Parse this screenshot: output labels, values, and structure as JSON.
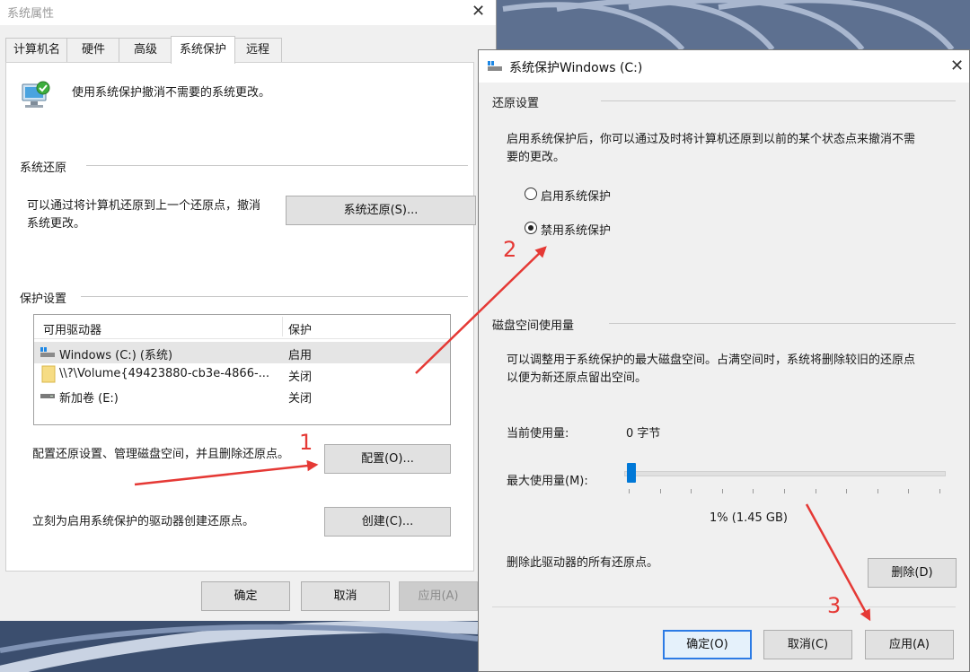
{
  "left_window": {
    "title": "系统属性",
    "tabs": [
      {
        "label": "计算机名"
      },
      {
        "label": "硬件"
      },
      {
        "label": "高级"
      },
      {
        "label": "系统保护"
      },
      {
        "label": "远程"
      }
    ],
    "active_tab": "系统保护",
    "intro_text": "使用系统保护撤消不需要的系统更改。",
    "restore_group": {
      "title": "系统还原",
      "desc_line1": "可以通过将计算机还原到上一个还原点，撤消",
      "desc_line2": "系统更改。",
      "button": "系统还原(S)..."
    },
    "protect_group": {
      "title": "保护设置",
      "columns": [
        "可用驱动器",
        "保护"
      ],
      "rows": [
        {
          "icon": "system-drive-icon",
          "name": "Windows (C:) (系统)",
          "status": "启用"
        },
        {
          "icon": "folder-icon",
          "name": "\\\\?\\Volume{49423880-cb3e-4866-...",
          "status": "关闭"
        },
        {
          "icon": "drive-icon",
          "name": "新加卷 (E:)",
          "status": "关闭"
        }
      ],
      "config_text": "配置还原设置、管理磁盘空间，并且删除还原点。",
      "config_button": "配置(O)...",
      "create_text": "立刻为启用系统保护的驱动器创建还原点。",
      "create_button": "创建(C)..."
    },
    "footer": {
      "ok": "确定",
      "cancel": "取消",
      "apply": "应用(A)"
    }
  },
  "right_window": {
    "title": "系统保护Windows (C:)",
    "restore_settings": {
      "title": "还原设置",
      "desc_line1": "启用系统保护后，你可以通过及时将计算机还原到以前的某个状态点来撤消不需",
      "desc_line2": "要的更改。",
      "option_enable": "启用系统保护",
      "option_disable": "禁用系统保护",
      "selected": "禁用系统保护"
    },
    "disk_usage": {
      "title": "磁盘空间使用量",
      "desc_line1": "可以调整用于系统保护的最大磁盘空间。占满空间时，系统将删除较旧的还原点",
      "desc_line2": "以便为新还原点留出空间。",
      "current_label": "当前使用量:",
      "current_value": "0 字节",
      "max_label": "最大使用量(M):",
      "max_value_text": "1% (1.45 GB)",
      "max_percent": 1,
      "delete_text": "删除此驱动器的所有还原点。",
      "delete_button": "删除(D)"
    },
    "footer": {
      "ok": "确定(O)",
      "cancel": "取消(C)",
      "apply": "应用(A)"
    }
  },
  "annotations": [
    {
      "label": "1"
    },
    {
      "label": "2"
    },
    {
      "label": "3"
    }
  ],
  "colors": {
    "annotation": "#e53935",
    "accent": "#0078d7"
  }
}
